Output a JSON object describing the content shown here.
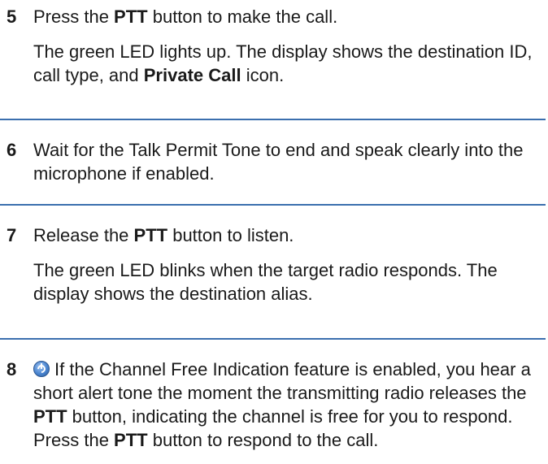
{
  "steps": [
    {
      "number": "5",
      "text1": {
        "a": "Press the ",
        "b": "PTT",
        "c": " button to make the call."
      },
      "text2": {
        "a": "The green LED lights up. The display shows the destination ID, call type, and ",
        "b": "Private Call",
        "c": " icon."
      }
    },
    {
      "number": "6",
      "text1": {
        "a": "Wait for the Talk Permit Tone to end and speak clearly into the microphone if enabled."
      }
    },
    {
      "number": "7",
      "text1": {
        "a": "Release the ",
        "b": "PTT",
        "c": " button to listen."
      },
      "text2": {
        "a": "The green LED blinks when the target radio responds. The display shows the destination alias."
      }
    },
    {
      "number": "8",
      "icon": "channel-free-indication-icon",
      "text1": {
        "a": "If the Channel Free Indication feature is enabled, you hear a short alert tone the moment the transmitting radio releases the ",
        "b": "PTT",
        "c": " button, indicating the channel is free for you to respond. Press the ",
        "d": "PTT",
        "e": " button to respond to the call."
      }
    }
  ],
  "colors": {
    "divider": "#3b6fae",
    "text": "#1a1a1a"
  }
}
